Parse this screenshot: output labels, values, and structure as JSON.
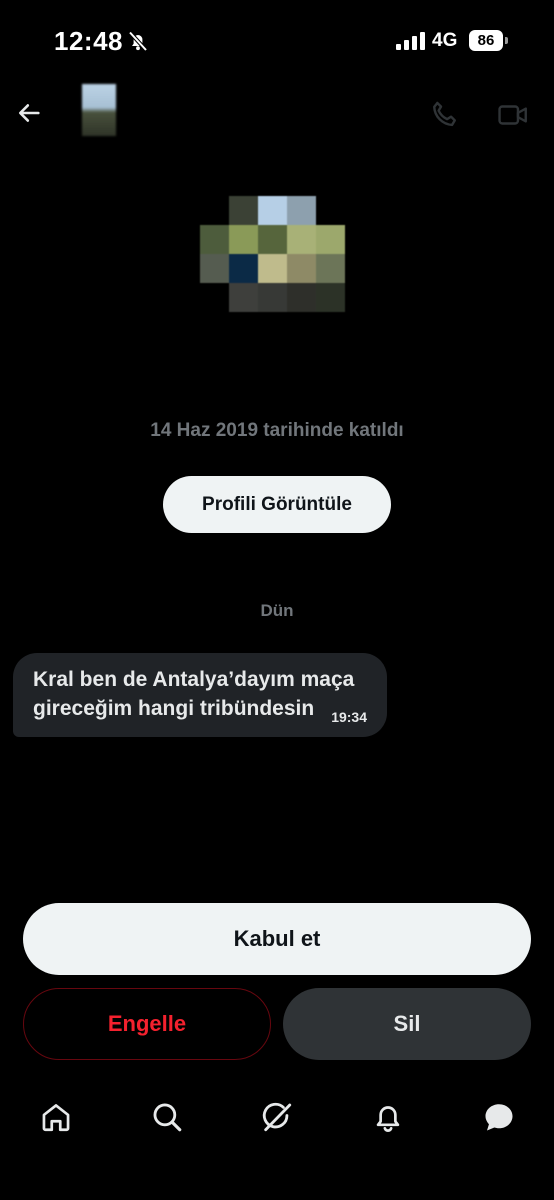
{
  "status_bar": {
    "time": "12:48",
    "network": "4G",
    "battery": "86",
    "icons": [
      "bell-mute-icon",
      "signal-bars-icon"
    ]
  },
  "header": {
    "icons": [
      "back-arrow-icon",
      "phone-icon",
      "video-camera-icon"
    ]
  },
  "profile": {
    "join_date": "14 Haz 2019 tarihinde katıldı",
    "view_profile_label": "Profili Görüntüle"
  },
  "conversation": {
    "day_label": "Dün",
    "messages": [
      {
        "text": "Kral ben de Antalya’dayım maça\ngireceğim hangi tribündesin",
        "time": "19:34"
      }
    ]
  },
  "actions": {
    "accept_label": "Kabul et",
    "block_label": "Engelle",
    "delete_label": "Sil"
  },
  "bottom_nav": {
    "items": [
      "home-icon",
      "search-icon",
      "grok-icon",
      "notifications-icon",
      "messages-icon"
    ],
    "active": "messages-icon"
  },
  "colors": {
    "background": "#000000",
    "primary_text": "#e7e9ea",
    "secondary_text": "#71767b",
    "bubble": "#202327",
    "danger": "#f4212e",
    "light_button": "#eff3f4"
  }
}
